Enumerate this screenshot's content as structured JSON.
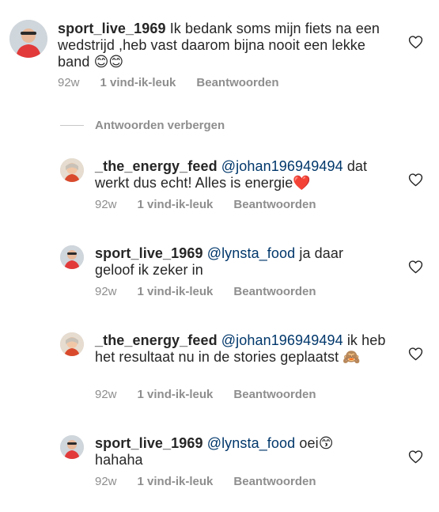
{
  "comments": [
    {
      "username": "sport_live_1969",
      "mention": "",
      "text": "Ik bedank soms mijn fiets na een wedstrijd ,heb vast daarom bijna nooit een lekke band",
      "emoji": "😊😊",
      "time": "92w",
      "likes": "1 vind-ik-leuk",
      "reply": "Beantwoorden"
    },
    {
      "username": "_the_energy_feed",
      "mention": "@johan196949494",
      "text": "dat werkt dus echt! Alles is energie",
      "emoji": "❤️",
      "time": "92w",
      "likes": "1 vind-ik-leuk",
      "reply": "Beantwoorden"
    },
    {
      "username": "sport_live_1969",
      "mention": "@lynsta_food",
      "text": "ja daar geloof ik zeker in",
      "emoji": "",
      "time": "92w",
      "likes": "1 vind-ik-leuk",
      "reply": "Beantwoorden"
    },
    {
      "username": "_the_energy_feed",
      "mention": "@johan196949494",
      "text": "ik heb het  resultaat nu in de stories geplaatst",
      "emoji": "🙈",
      "time": "92w",
      "likes": "1 vind-ik-leuk",
      "reply": "Beantwoorden"
    },
    {
      "username": "sport_live_1969",
      "mention": "@lynsta_food",
      "text": "oei",
      "emoji": "😙",
      "text2": "hahaha",
      "time": "92w",
      "likes": "1 vind-ik-leuk",
      "reply": "Beantwoorden"
    }
  ],
  "hide_replies_label": "Antwoorden verbergen",
  "icons": {
    "like": "heart-outline-icon"
  },
  "colors": {
    "mention": "#00376b",
    "meta": "#8e8e8e",
    "text": "#262626"
  }
}
